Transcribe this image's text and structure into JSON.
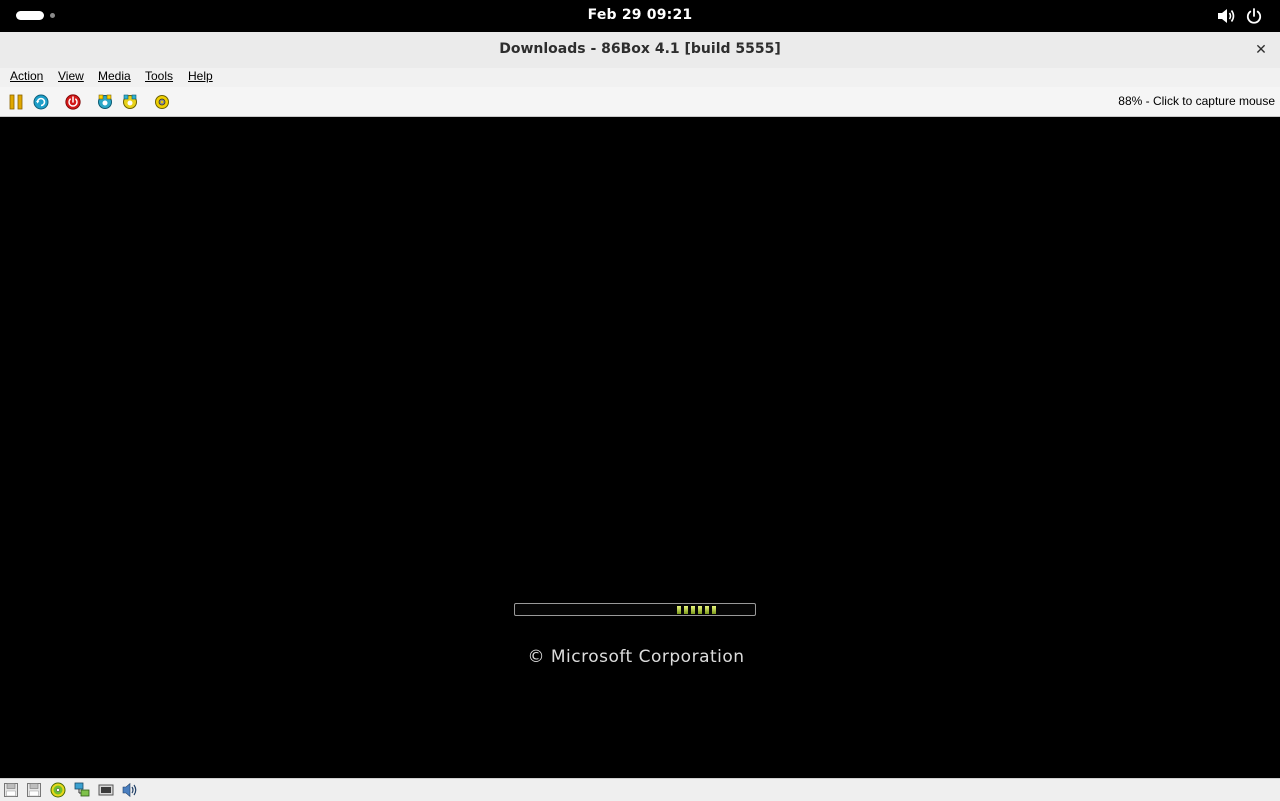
{
  "topbar": {
    "clock": "Feb 29  09:21",
    "icons": [
      "activities-indicator",
      "volume-icon",
      "power-icon"
    ]
  },
  "window": {
    "title": "Downloads - 86Box 4.1 [build 5555]",
    "close_glyph": "✕"
  },
  "menu": {
    "items": [
      "Action",
      "View",
      "Media",
      "Tools",
      "Help"
    ]
  },
  "toolbar": {
    "buttons": [
      "pause-icon",
      "reset-icon",
      "power-off-icon",
      "ctrl-alt-del-icon",
      "ctrl-alt-esc-icon",
      "settings-icon"
    ],
    "capture_hint": "88% - Click to capture mouse"
  },
  "screen": {
    "copyright": "© Microsoft Corporation",
    "progress_segments": 6,
    "segment_color": "#b5cf2f"
  },
  "statusbar": {
    "icons": [
      "floppy-drive-1-icon",
      "floppy-drive-2-icon",
      "cd-drive-icon",
      "network-icon",
      "display-icon",
      "sound-icon"
    ]
  },
  "colors": {
    "topbar_bg": "#000000",
    "titlebar_bg": "#ebebeb",
    "menubar_bg": "#f1f1f1",
    "screen_bg": "#000000"
  }
}
